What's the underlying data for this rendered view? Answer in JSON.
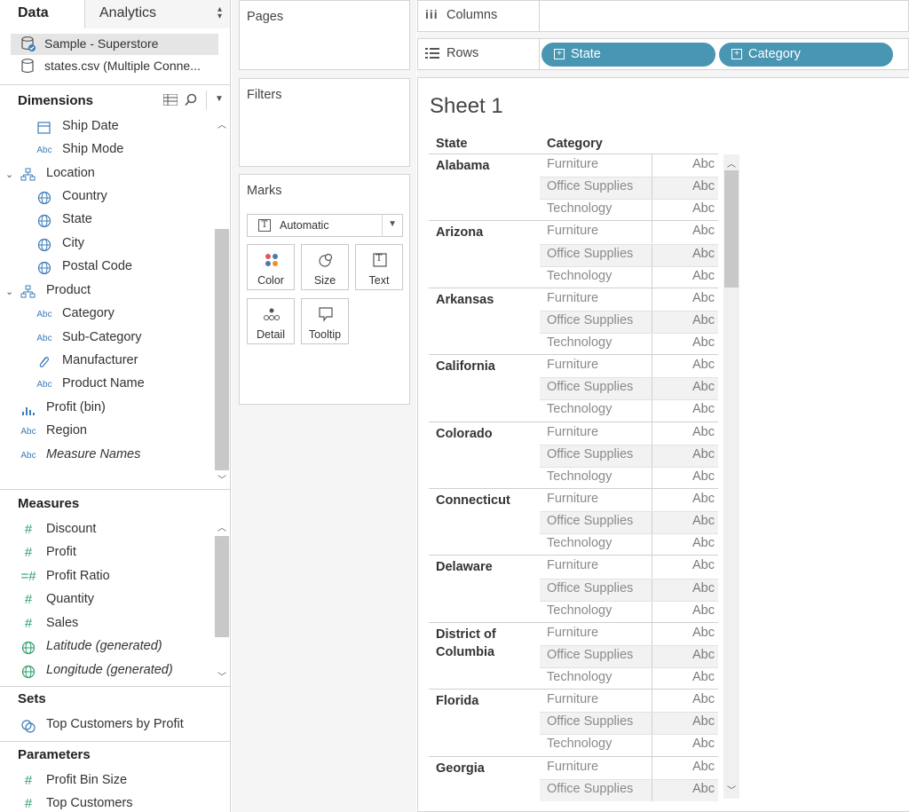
{
  "tabs": {
    "data": "Data",
    "analytics": "Analytics"
  },
  "datasources": [
    "Sample - Superstore",
    "states.csv (Multiple Conne..."
  ],
  "dimensions": {
    "title": "Dimensions",
    "items": [
      {
        "label": "Ship Date",
        "icon": "calendar-icon"
      },
      {
        "label": "Ship Mode",
        "icon": "abc-icon",
        "icon_text": "Abc"
      },
      {
        "label": "Location",
        "icon": "hierarchy-icon"
      },
      {
        "label": "Country",
        "icon": "globe-icon"
      },
      {
        "label": "State",
        "icon": "globe-icon"
      },
      {
        "label": "City",
        "icon": "globe-icon"
      },
      {
        "label": "Postal Code",
        "icon": "globe-icon"
      },
      {
        "label": "Product",
        "icon": "hierarchy-icon"
      },
      {
        "label": "Category",
        "icon": "abc-icon",
        "icon_text": "Abc"
      },
      {
        "label": "Sub-Category",
        "icon": "abc-icon",
        "icon_text": "Abc"
      },
      {
        "label": "Manufacturer",
        "icon": "paperclip-icon"
      },
      {
        "label": "Product Name",
        "icon": "abc-icon",
        "icon_text": "Abc"
      },
      {
        "label": "Profit (bin)",
        "icon": "histogram-icon"
      },
      {
        "label": "Region",
        "icon": "abc-icon",
        "icon_text": "Abc"
      },
      {
        "label": "Measure Names",
        "icon": "abc-icon",
        "icon_text": "Abc"
      }
    ]
  },
  "measures": {
    "title": "Measures",
    "items": [
      {
        "label": "Discount",
        "icon": "hash-icon"
      },
      {
        "label": "Profit",
        "icon": "hash-icon"
      },
      {
        "label": "Profit Ratio",
        "icon": "calc-hash-icon"
      },
      {
        "label": "Quantity",
        "icon": "hash-icon"
      },
      {
        "label": "Sales",
        "icon": "hash-icon"
      },
      {
        "label": "Latitude (generated)",
        "icon": "globe-icon"
      },
      {
        "label": "Longitude (generated)",
        "icon": "globe-icon"
      }
    ]
  },
  "sets": {
    "title": "Sets",
    "items": [
      {
        "label": "Top Customers by Profit",
        "icon": "set-icon"
      }
    ]
  },
  "parameters": {
    "title": "Parameters",
    "items": [
      {
        "label": "Profit Bin Size",
        "icon": "hash-icon"
      },
      {
        "label": "Top Customers",
        "icon": "hash-icon"
      }
    ]
  },
  "cards": {
    "pages": "Pages",
    "filters": "Filters",
    "marks": "Marks"
  },
  "marks": {
    "type": "Automatic",
    "buttons": [
      {
        "label": "Color",
        "icon": "color-icon"
      },
      {
        "label": "Size",
        "icon": "size-icon"
      },
      {
        "label": "Text",
        "icon": "text-icon",
        "icon_text": "T"
      },
      {
        "label": "Detail",
        "icon": "detail-icon"
      },
      {
        "label": "Tooltip",
        "icon": "tooltip-icon"
      }
    ]
  },
  "shelves": {
    "columns": "Columns",
    "rows": "Rows",
    "row_pills": [
      "State",
      "Category"
    ]
  },
  "sheet": {
    "title": "Sheet 1",
    "col_headers": [
      "State",
      "Category"
    ],
    "cell_text": "Abc",
    "groups": [
      {
        "state": "Alabama",
        "categories": [
          "Furniture",
          "Office Supplies",
          "Technology"
        ]
      },
      {
        "state": "Arizona",
        "categories": [
          "Furniture",
          "Office Supplies",
          "Technology"
        ]
      },
      {
        "state": "Arkansas",
        "categories": [
          "Furniture",
          "Office Supplies",
          "Technology"
        ]
      },
      {
        "state": "California",
        "categories": [
          "Furniture",
          "Office Supplies",
          "Technology"
        ]
      },
      {
        "state": "Colorado",
        "categories": [
          "Furniture",
          "Office Supplies",
          "Technology"
        ]
      },
      {
        "state": "Connecticut",
        "categories": [
          "Furniture",
          "Office Supplies",
          "Technology"
        ]
      },
      {
        "state": "Delaware",
        "categories": [
          "Furniture",
          "Office Supplies",
          "Technology"
        ]
      },
      {
        "state": "District of Columbia",
        "categories": [
          "Furniture",
          "Office Supplies",
          "Technology"
        ]
      },
      {
        "state": "Florida",
        "categories": [
          "Furniture",
          "Office Supplies",
          "Technology"
        ]
      },
      {
        "state": "Georgia",
        "categories": [
          "Furniture",
          "Office Supplies"
        ]
      }
    ]
  },
  "colors": {
    "pill": "#4996b2",
    "dimension_icon": "#3c7cb8",
    "measure_icon": "#2e9e6a"
  }
}
